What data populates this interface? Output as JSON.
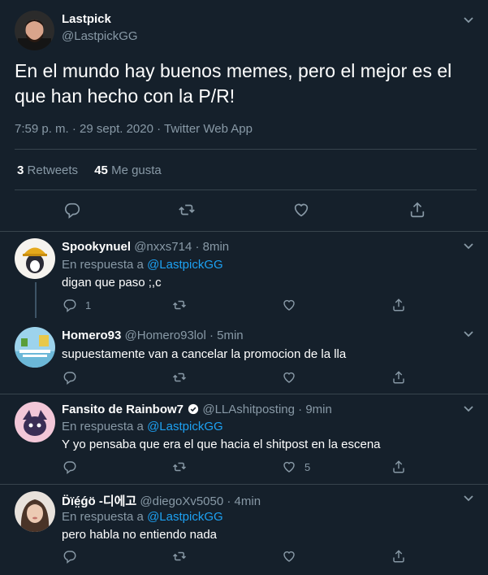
{
  "main": {
    "name": "Lastpick",
    "handle": "@LastpickGG",
    "text": "En el mundo hay buenos memes, pero el mejor es el que han hecho con la P/R!",
    "meta": "7:59 p. m. · 29 sept. 2020 · Twitter Web App",
    "retweets_count": "3",
    "retweets_label": "Retweets",
    "likes_count": "45",
    "likes_label": "Me gusta"
  },
  "replies": [
    {
      "name": "Spookynuel",
      "handle_time": "@nxxs714 · 8min",
      "in_reply_label": "En respuesta a ",
      "in_reply_handle": "@LastpickGG",
      "text": "digan que paso ;,c",
      "reply_count": "1",
      "like_count": ""
    },
    {
      "name": "Homero93",
      "handle_time": "@Homero93lol · 5min",
      "text": "supuestamente van a cancelar la promocion de la lla",
      "reply_count": "",
      "like_count": ""
    },
    {
      "name": "Fansito de Rainbow7",
      "handle_time": "@LLAshitposting · 9min",
      "in_reply_label": "En respuesta a ",
      "in_reply_handle": "@LastpickGG",
      "text": "Y yo pensaba que era el que hacia el shitpost en la escena",
      "reply_count": "",
      "like_count": "5"
    },
    {
      "name": "D̈ïé̤ǵö -디에고",
      "handle_time": "@diegoXv5050 · 4min",
      "in_reply_label": "En respuesta a ",
      "in_reply_handle": "@LastpickGG",
      "text": "pero habla no entiendo nada",
      "reply_count": "",
      "like_count": ""
    }
  ],
  "colors": {
    "background": "#15202b",
    "border": "#38444d",
    "secondary_text": "#8899a6",
    "link": "#1da1f2"
  },
  "icons": [
    "chevron-down-icon",
    "reply-icon",
    "retweet-icon",
    "like-icon",
    "share-icon",
    "verified-badge-icon"
  ]
}
